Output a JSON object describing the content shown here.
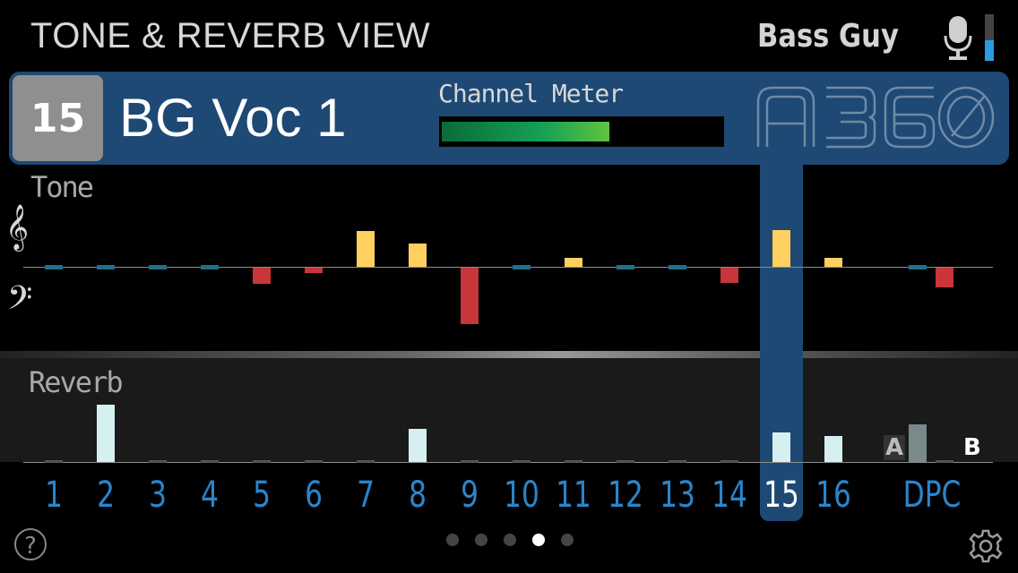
{
  "header": {
    "title": "TONE & REVERB VIEW",
    "user": "Bass Guy",
    "mic_level": 0.45
  },
  "channel": {
    "number": "15",
    "name": "BG Voc 1",
    "meter_label": "Channel Meter",
    "meter_level": 0.6,
    "logo_text": "A360"
  },
  "sections": {
    "tone_label": "Tone",
    "reverb_label": "Reverb",
    "treble_clef": "𝄞",
    "bass_clef": "𝄢"
  },
  "channels": {
    "labels": [
      "1",
      "2",
      "3",
      "4",
      "5",
      "6",
      "7",
      "8",
      "9",
      "10",
      "11",
      "12",
      "13",
      "14",
      "15",
      "16",
      "DPC"
    ],
    "active": "15",
    "tone": [
      0,
      0,
      0,
      0,
      -18,
      -6,
      40,
      26,
      -63,
      0,
      10,
      0,
      0,
      -17,
      41,
      10,
      0,
      -22
    ],
    "reverb": [
      0,
      64,
      0,
      0,
      0,
      0,
      0,
      37,
      0,
      0,
      0,
      0,
      0,
      0,
      33,
      29,
      42,
      0
    ],
    "dpc_a": "A",
    "dpc_b": "B"
  },
  "pager": {
    "count": 5,
    "active": 3
  },
  "colors": {
    "header_blue": "#1d4974",
    "channel_label_blue": "#2a85cc",
    "tone_positive": "#ffd060",
    "tone_negative": "#c8353a",
    "tone_zero": "#1e6f8c",
    "reverb_bar": "#d6f0f2",
    "reverb_dpc": "#7a8a8a"
  },
  "icons": {
    "mic": "microphone-icon",
    "help": "help-icon",
    "settings": "gear-icon"
  },
  "help_glyph": "?"
}
